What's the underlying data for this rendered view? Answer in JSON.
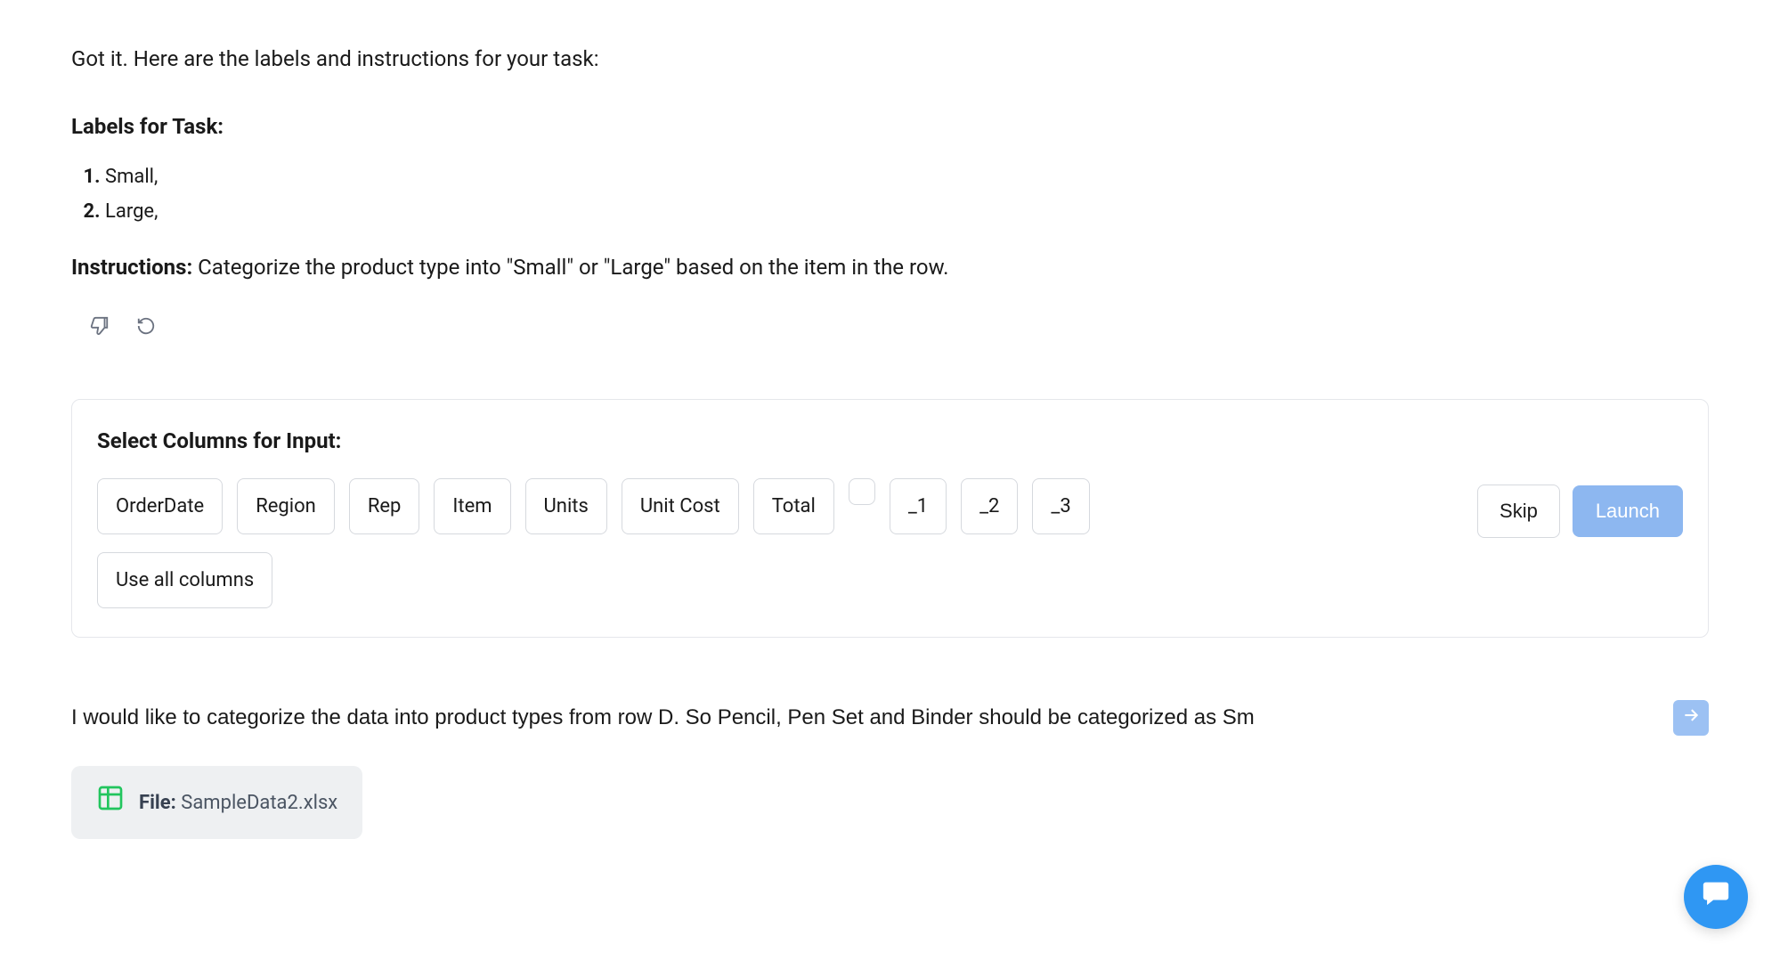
{
  "intro": "Got it. Here are the labels and instructions for your task:",
  "labels_heading": "Labels for Task:",
  "labels": [
    "Small,",
    "Large,"
  ],
  "instructions_label": "Instructions:",
  "instructions_text": " Categorize the product type into \"Small\" or \"Large\" based on the item in the row.",
  "select_heading": "Select Columns for Input:",
  "columns": [
    "OrderDate",
    "Region",
    "Rep",
    "Item",
    "Units",
    "Unit Cost",
    "Total",
    "",
    "_1",
    "_2",
    "_3"
  ],
  "use_all_label": "Use all columns",
  "skip_label": "Skip",
  "launch_label": "Launch",
  "prompt_value": "I would like to categorize the data into product types from row D. So Pencil, Pen Set and Binder should be categorized as Sm",
  "file_prefix": "File: ",
  "file_name": "SampleData2.xlsx"
}
